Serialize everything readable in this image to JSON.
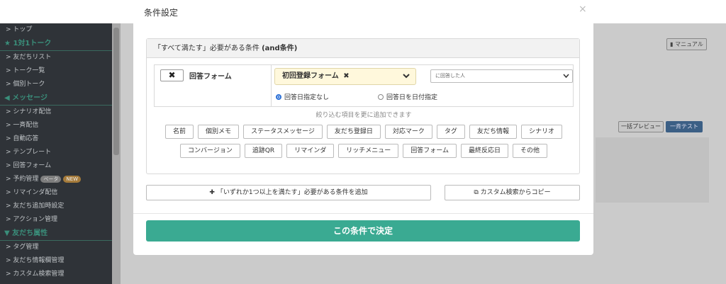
{
  "modal": {
    "title": "条件設定",
    "close_glyph": "×",
    "and_header_prefix": "「すべて満たす」必要がある条件",
    "and_header_suffix": "(and条件)",
    "condition": {
      "remove_glyph": "✖",
      "label": "回答フォーム",
      "form_select": "初回登録フォーム",
      "form_select_clear": "✖",
      "response_select": "に回答した人",
      "radio_no_date": "回答日指定なし",
      "radio_date": "回答日を日付指定"
    },
    "narrow_text": "絞り込む項目を更に追加できます",
    "chips_row1": [
      "名前",
      "個別メモ",
      "ステータスメッセージ",
      "友だち登録日",
      "対応マーク",
      "タグ",
      "友だち情報",
      "シナリオ"
    ],
    "chips_row2": [
      "コンバージョン",
      "追跡QR",
      "リマインダ",
      "リッチメニュー",
      "回答フォーム",
      "最終反応日",
      "その他"
    ],
    "add_or_label": "「いずれか1つ以上を満たす」必要がある条件を追加",
    "copy_label": "カスタム検索からコピー",
    "decide_label": "この条件で決定"
  },
  "background": {
    "manual_label": "マニュアル",
    "preview_label": "一括プレビュー",
    "test_label": "一斉テスト",
    "sidebar": [
      {
        "type": "item",
        "label": "> トップ"
      },
      {
        "type": "head",
        "label": "★ 1対1トーク"
      },
      {
        "type": "item",
        "label": "> 友だちリスト"
      },
      {
        "type": "item",
        "label": "> トーク一覧"
      },
      {
        "type": "item",
        "label": "> 個別トーク"
      },
      {
        "type": "head",
        "label": "◀ メッセージ"
      },
      {
        "type": "item",
        "label": "> シナリオ配信"
      },
      {
        "type": "item",
        "label": "> 一斉配信"
      },
      {
        "type": "item",
        "label": "> 自動応答"
      },
      {
        "type": "item",
        "label": "> テンプレート"
      },
      {
        "type": "item",
        "label": "> 回答フォーム"
      },
      {
        "type": "item",
        "label": "> 予約管理",
        "badges": [
          "ベータ",
          "NEW"
        ]
      },
      {
        "type": "item",
        "label": "> リマインダ配信"
      },
      {
        "type": "item",
        "label": "> 友だち追加時設定"
      },
      {
        "type": "item",
        "label": "> アクション管理"
      },
      {
        "type": "head",
        "label": "▼ 友だち属性"
      },
      {
        "type": "item",
        "label": "> タグ管理"
      },
      {
        "type": "item",
        "label": "> 友だち情報欄管理"
      },
      {
        "type": "item",
        "label": "> カスタム検索管理"
      }
    ]
  },
  "colors": {
    "accent": "#3aaa92",
    "select_bg": "#fff8dc",
    "radio_on": "#2a6fd6"
  }
}
